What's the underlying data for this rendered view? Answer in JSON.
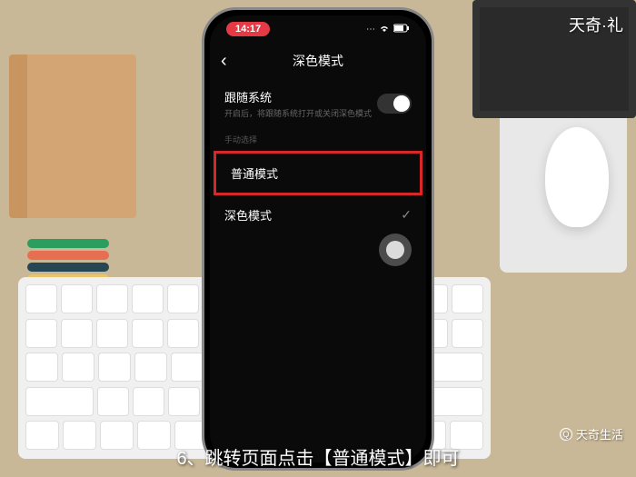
{
  "status_bar": {
    "time": "14:17"
  },
  "nav": {
    "title": "深色模式"
  },
  "follow_system": {
    "label": "跟随系统",
    "description": "开启后，将跟随系统打开或关闭深色模式"
  },
  "section_label": "手动选择",
  "options": {
    "normal": "普通模式",
    "dark": "深色模式"
  },
  "caption": "6、跳转页面点击【普通模式】即可",
  "watermarks": {
    "top_right": "天奇·礼",
    "bottom_right": "天奇生活",
    "icon_letter": "Q"
  }
}
